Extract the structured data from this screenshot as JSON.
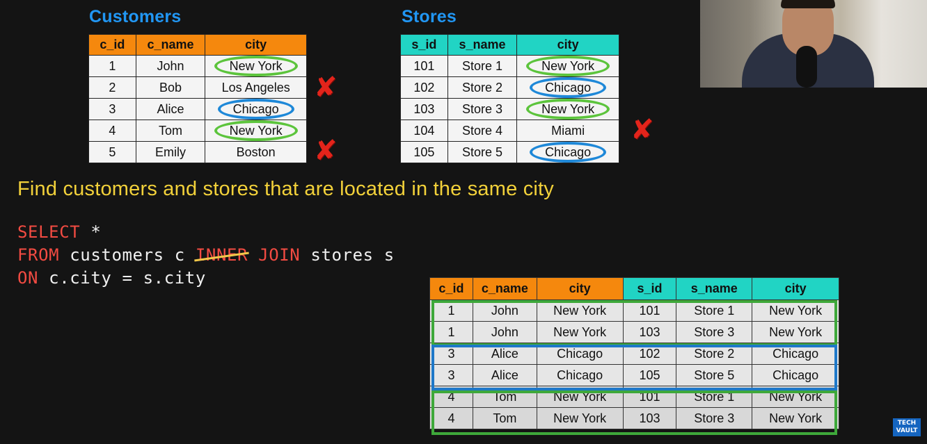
{
  "customers": {
    "title": "Customers",
    "headers": [
      "c_id",
      "c_name",
      "city"
    ],
    "rows": [
      {
        "c_id": "1",
        "c_name": "John",
        "city": "New York",
        "highlight": "green",
        "matched": true
      },
      {
        "c_id": "2",
        "c_name": "Bob",
        "city": "Los Angeles",
        "highlight": "none",
        "matched": false
      },
      {
        "c_id": "3",
        "c_name": "Alice",
        "city": "Chicago",
        "highlight": "blue",
        "matched": true
      },
      {
        "c_id": "4",
        "c_name": "Tom",
        "city": "New York",
        "highlight": "green",
        "matched": true
      },
      {
        "c_id": "5",
        "c_name": "Emily",
        "city": "Boston",
        "highlight": "none",
        "matched": false
      }
    ]
  },
  "stores": {
    "title": "Stores",
    "headers": [
      "s_id",
      "s_name",
      "city"
    ],
    "rows": [
      {
        "s_id": "101",
        "s_name": "Store 1",
        "city": "New York",
        "highlight": "green",
        "matched": true
      },
      {
        "s_id": "102",
        "s_name": "Store 2",
        "city": "Chicago",
        "highlight": "blue",
        "matched": true
      },
      {
        "s_id": "103",
        "s_name": "Store 3",
        "city": "New York",
        "highlight": "green",
        "matched": true
      },
      {
        "s_id": "104",
        "s_name": "Store 4",
        "city": "Miami",
        "highlight": "none",
        "matched": false
      },
      {
        "s_id": "105",
        "s_name": "Store 5",
        "city": "Chicago",
        "highlight": "blue",
        "matched": true
      }
    ]
  },
  "question": "Find customers and stores that are located in the same city",
  "sql": {
    "line1_kw": "SELECT",
    "line1_rest": " *",
    "line2_kw": "FROM",
    "line2_mid": " customers c ",
    "line2_struck": "INNER",
    "line2_kw2": " JOIN",
    "line2_rest": " stores s",
    "line3_kw": "ON",
    "line3_rest": " c.city = s.city"
  },
  "result": {
    "headers": [
      "c_id",
      "c_name",
      "city",
      "s_id",
      "s_name",
      "city"
    ],
    "rows": [
      [
        "1",
        "John",
        "New York",
        "101",
        "Store 1",
        "New York"
      ],
      [
        "1",
        "John",
        "New York",
        "103",
        "Store 3",
        "New York"
      ],
      [
        "3",
        "Alice",
        "Chicago",
        "102",
        "Store 2",
        "Chicago"
      ],
      [
        "3",
        "Alice",
        "Chicago",
        "105",
        "Store 5",
        "Chicago"
      ],
      [
        "4",
        "Tom",
        "New York",
        "101",
        "Store 1",
        "New York"
      ],
      [
        "4",
        "Tom",
        "New York",
        "103",
        "Store 3",
        "New York"
      ]
    ]
  },
  "colors": {
    "customers_header": "#f5880d",
    "stores_header": "#21d4c4",
    "match_green": "#5cc43c",
    "match_blue": "#1e88d8",
    "no_match_x": "#e3241b",
    "title_blue": "#2196f3",
    "question_yellow": "#f2d13a",
    "sql_keyword": "#f24b42"
  },
  "logo": {
    "line1": "TECH",
    "line2": "VAULT"
  }
}
